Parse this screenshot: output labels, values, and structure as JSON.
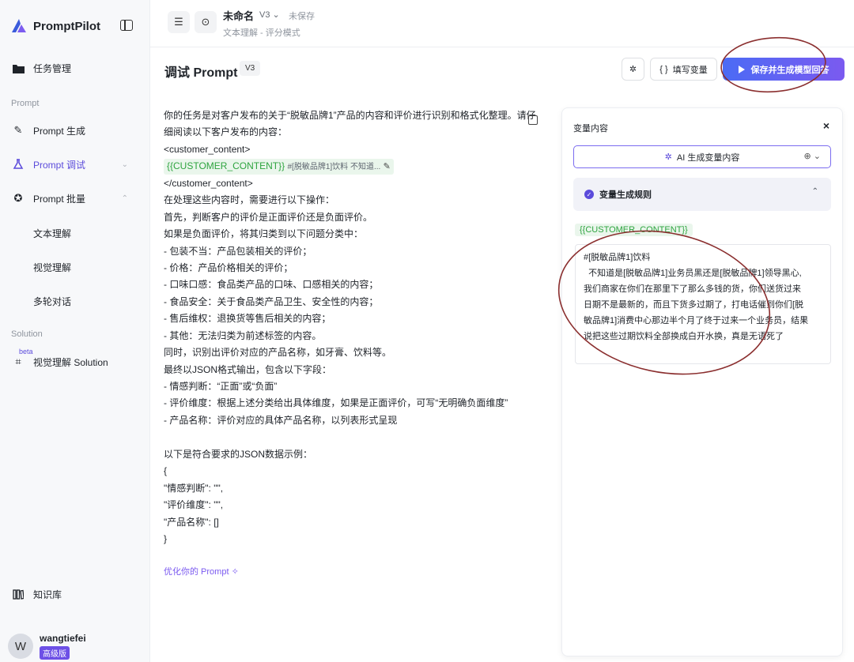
{
  "app": {
    "name": "PromptPilot"
  },
  "sidebar": {
    "task_manage": "任务管理",
    "section_prompt": "Prompt",
    "prompt_gen": "Prompt 生成",
    "prompt_debug": "Prompt 调试",
    "prompt_batch": "Prompt 批量",
    "sub_items": [
      "文本理解",
      "视觉理解",
      "多轮对话"
    ],
    "section_solution": "Solution",
    "beta": "beta",
    "visual_solution": "视觉理解 Solution",
    "knowledge": "知识库",
    "user": {
      "initial": "W",
      "name": "wangtiefei",
      "badge": "高级版"
    }
  },
  "topbar": {
    "title": "未命名",
    "version": "V3",
    "status": "未保存",
    "breadcrumb": "文本理解 - 评分模式"
  },
  "header": {
    "title": "调试 Prompt",
    "version": "V3",
    "fill_vars": "填写变量",
    "save_generate": "保存并生成模型回答"
  },
  "prompt": {
    "lines_before": [
      "你的任务是对客户发布的关于“脱敏品牌1”产品的内容和评价进行识别和格式化整理。请仔",
      "细阅读以下客户发布的内容：",
      "<customer_content>"
    ],
    "var_name": "{{CUSTOMER_CONTENT}}",
    "var_value": "#[脱敏品牌1]饮料 不知道...",
    "lines_after": [
      "</customer_content>",
      "在处理这些内容时，需要进行以下操作：",
      "首先，判断客户的评价是正面评价还是负面评价。",
      "如果是负面评价，将其归类到以下问题分类中：",
      "- 包装不当：产品包装相关的评价；",
      "- 价格：产品价格相关的评价；",
      "- 口味口感：食品类产品的口味、口感相关的内容；",
      "- 食品安全：关于食品类产品卫生、安全性的内容；",
      "- 售后维权：退换货等售后相关的内容；",
      "- 其他：无法归类为前述标签的内容。",
      "同时，识别出评价对应的产品名称，如牙膏、饮料等。",
      "最终以JSON格式输出，包含以下字段：",
      "- 情感判断：“正面”或“负面”",
      "- 评价维度：根据上述分类给出具体维度，如果是正面评价，可写“无明确负面维度”",
      "- 产品名称：评价对应的具体产品名称，以列表形式呈现",
      "",
      "以下是符合要求的JSON数据示例：",
      "{",
      "\"情感判断\": \"\",",
      "\"评价维度\": \"\",",
      "\"产品名称\": []",
      "}"
    ],
    "optimize": "优化你的 Prompt"
  },
  "panel": {
    "title": "变量内容",
    "ai_generate": "AI 生成变量内容",
    "rules": "变量生成规则",
    "var_label": "{{CUSTOMER_CONTENT}}",
    "var_value_lines": [
      "#[脱敏品牌1]饮料",
      "  不知道是[脱敏品牌1]业务员黑还是[脱敏品牌1]领导黑心,",
      "我们商家在你们在那里下了那么多钱的货，你们送货过来",
      "日期不是最新的，而且下货多过期了，打电话催到你们[脱",
      "敏品牌1]消费中心那边半个月了终于过来一个业务员，结果",
      "说把这些过期饮料全部换成白开水换，真是无语死了"
    ]
  },
  "colors": {
    "accent": "#5b4bdb",
    "variable": "#2ea43f",
    "annotation": "#8b2f2f"
  }
}
